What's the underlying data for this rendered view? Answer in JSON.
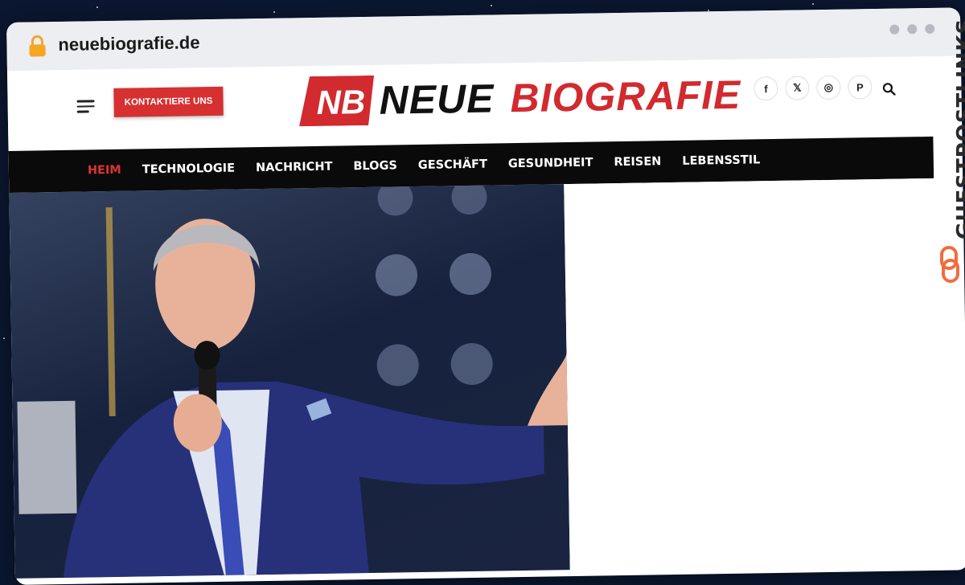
{
  "browser": {
    "url": "neuebiografie.de"
  },
  "header": {
    "contact_button": "KONTAKTIERE UNS",
    "logo_mark": "NB",
    "logo_word1": "NEUE",
    "logo_word2": "BIOGRAFIE",
    "social": [
      {
        "icon": "facebook-icon",
        "glyph": "f"
      },
      {
        "icon": "x-twitter-icon",
        "glyph": "𝕏"
      },
      {
        "icon": "instagram-icon",
        "glyph": "◎"
      },
      {
        "icon": "pinterest-icon",
        "glyph": "P"
      }
    ]
  },
  "nav": {
    "items": [
      "HEIM",
      "TECHNOLOGIE",
      "NACHRICHT",
      "BLOGS",
      "GESCHÄFT",
      "GESUNDHEIT",
      "REISEN",
      "LEBENSSTIL"
    ],
    "active_index": 0
  },
  "watermark": {
    "text": "GUESTPOSTLINKS"
  },
  "colors": {
    "accent": "#d63031",
    "nav_bg": "#0a0a0a",
    "logo_red": "#d12a2f"
  }
}
